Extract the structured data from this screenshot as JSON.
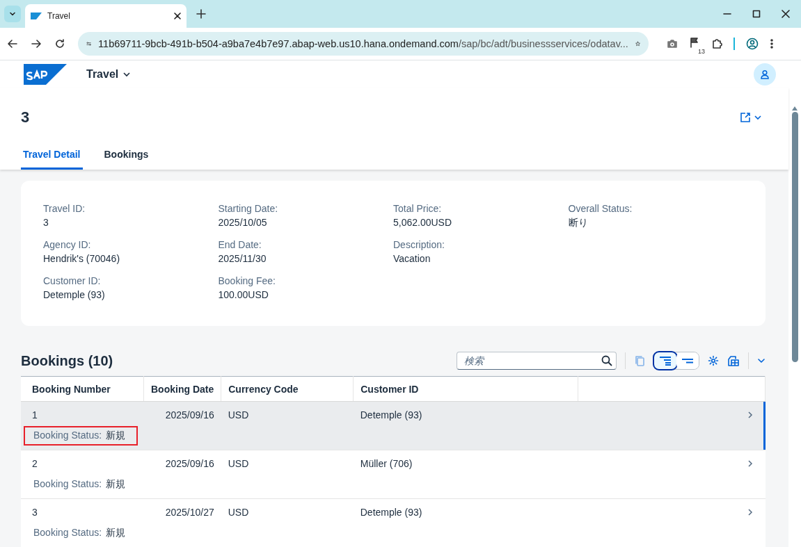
{
  "browser": {
    "tab_title": "Travel",
    "url_host": "11b69711-9bcb-491b-b504-a9ba7e4b7e97.abap-web.us10.hana.ondemand.com",
    "url_path": "/sap/bc/adt/businessservices/odatav...",
    "extension_badge": "13"
  },
  "shell": {
    "app_title": "Travel"
  },
  "object": {
    "title": "3",
    "tabs": [
      {
        "label": "Travel Detail",
        "selected": true
      },
      {
        "label": "Bookings",
        "selected": false
      }
    ]
  },
  "details": [
    [
      {
        "label": "Travel ID:",
        "value": "3"
      },
      {
        "label": "Agency ID:",
        "value": "Hendrik's (70046)"
      },
      {
        "label": "Customer ID:",
        "value": "Detemple (93)"
      }
    ],
    [
      {
        "label": "Starting Date:",
        "value": "2025/10/05"
      },
      {
        "label": "End Date:",
        "value": "2025/11/30"
      },
      {
        "label": "Booking Fee:",
        "value": "100.00USD"
      }
    ],
    [
      {
        "label": "Total Price:",
        "value": "5,062.00USD"
      },
      {
        "label": "Description:",
        "value": "Vacation"
      }
    ],
    [
      {
        "label": "Overall Status:",
        "value": "断り"
      }
    ]
  ],
  "bookings": {
    "title": "Bookings (10)",
    "search": {
      "placeholder": "検索"
    },
    "columns": [
      "Booking Number",
      "Booking Date",
      "Currency Code",
      "Customer ID"
    ],
    "rows": [
      {
        "cells": [
          "1",
          "2025/09/16",
          "USD",
          "Detemple (93)"
        ],
        "status_label": "Booking Status:",
        "status_value": "新規",
        "selected": true,
        "highlighted": true
      },
      {
        "cells": [
          "2",
          "2025/09/16",
          "USD",
          "Müller (706)"
        ],
        "status_label": "Booking Status:",
        "status_value": "新規",
        "selected": false,
        "highlighted": false
      },
      {
        "cells": [
          "3",
          "2025/10/27",
          "USD",
          "Detemple (93)"
        ],
        "status_label": "Booking Status:",
        "status_value": "新規",
        "selected": false,
        "highlighted": false
      }
    ]
  }
}
